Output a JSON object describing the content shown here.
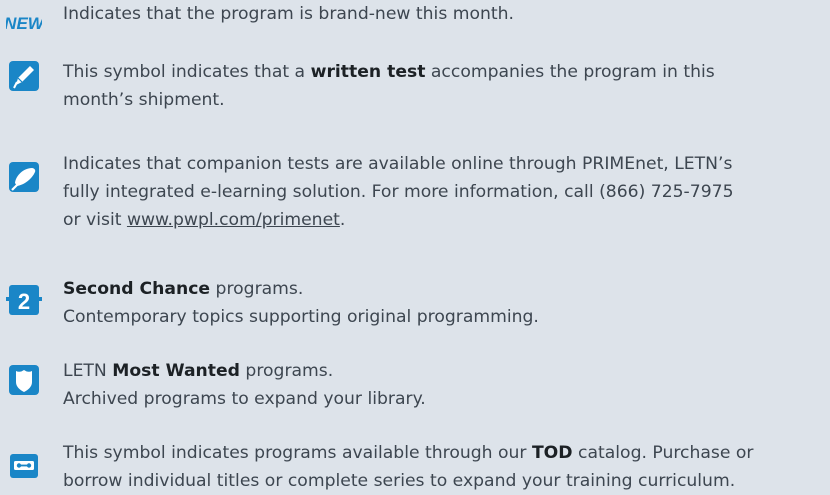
{
  "legend": {
    "new": {
      "icon": "new-badge-icon",
      "icon_text": "NEW",
      "text": "Indicates that the program is brand-new this month."
    },
    "written_test": {
      "icon": "pencil-icon",
      "pre": "This symbol indicates that a ",
      "bold": "written test",
      "post1": " accompanies the program in this",
      "line2": "month’s shipment."
    },
    "online_tests": {
      "icon": "eraser-pencil-icon",
      "line1": "Indicates that companion tests are available online through PRIMEnet, LETN’s",
      "line2": "fully integrated e-learning solution. For more information, call (866) 725-7975",
      "line3_pre": "or visit ",
      "link": "www.pwpl.com/primenet",
      "line3_post": "."
    },
    "second_chance": {
      "icon": "number-2-icon",
      "icon_text": "2",
      "bold": "Second Chance",
      "post": " programs.",
      "line2": "Contemporary topics supporting original programming."
    },
    "most_wanted": {
      "icon": "badge-shield-icon",
      "pre": "LETN ",
      "bold": "Most Wanted",
      "post": " programs.",
      "line2": "Archived programs to expand your library."
    },
    "tod": {
      "icon": "videotape-icon",
      "pre": "This symbol indicates programs available through our ",
      "bold": "TOD",
      "post": " catalog. Purchase or",
      "line2": "borrow individual titles or complete series to expand your training curriculum."
    }
  },
  "colors": {
    "icon_blue": "#1a86c7",
    "background": "#dde3ea",
    "text": "#3d4650"
  }
}
